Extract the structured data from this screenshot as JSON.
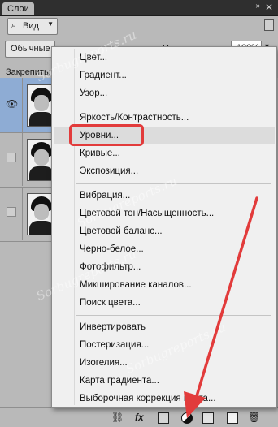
{
  "panel": {
    "tab_title": "Слои",
    "filter_label": "Вид",
    "blend_mode": "Обычные",
    "opacity_label": "Непрозрачность:",
    "opacity_value": "100%",
    "lock_label": "Закрепить:"
  },
  "menu": {
    "items": [
      "Цвет...",
      "Градиент...",
      "Узор...",
      "Яркость/Контрастность...",
      "Уровни...",
      "Кривые...",
      "Экспозиция...",
      "Вибрация...",
      "Цветовой тон/Насыщенность...",
      "Цветовой баланс...",
      "Черно-белое...",
      "Фотофильтр...",
      "Микширование каналов...",
      "Поиск цвета...",
      "Инвертировать",
      "Постеризация...",
      "Изогелия...",
      "Карта градиента...",
      "Выборочная коррекция цвета..."
    ],
    "highlighted_item": "Уровни..."
  },
  "watermark": "Sorbugreports.ru",
  "colors": {
    "highlight": "#e23b3b",
    "selected_layer": "#8eacd4",
    "panel_bg": "#b9b9b9",
    "menu_bg": "#f0f0f0"
  },
  "icons": {
    "bottom_bar": [
      "link-icon",
      "fx-icon",
      "mask-icon",
      "adjustment-layer-icon",
      "group-folder-icon",
      "new-layer-icon",
      "trash-icon"
    ]
  }
}
